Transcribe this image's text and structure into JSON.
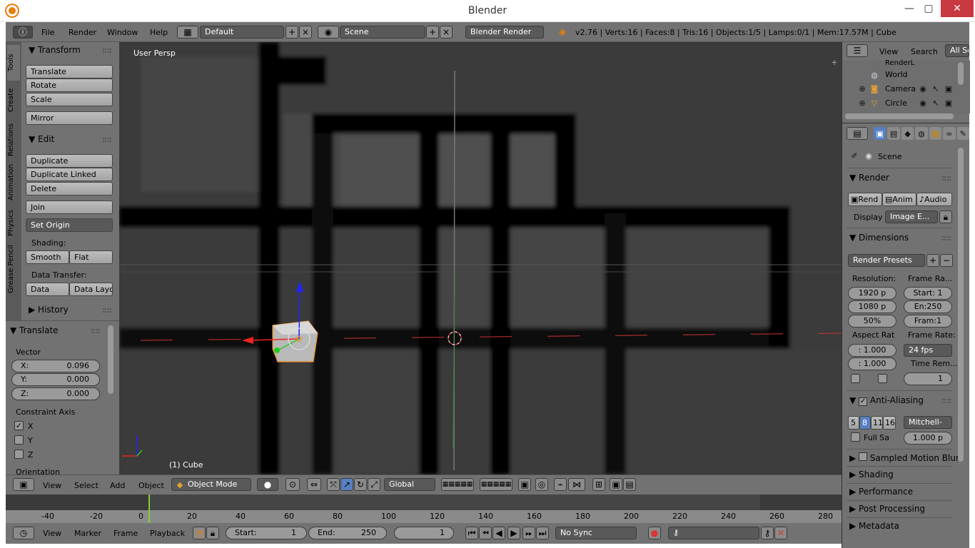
{
  "window": {
    "title": "Blender",
    "minimize": "—",
    "maximize": "▢",
    "close": "✕"
  },
  "info_header": {
    "menus": [
      "File",
      "Render",
      "Window",
      "Help"
    ],
    "screen_layout": "Default",
    "scene": "Scene",
    "render_engine": "Blender Render",
    "stats": "v2.76 | Verts:16 | Faces:8 | Tris:16 | Objects:1/5 | Lamps:0/1 | Mem:17.57M | Cube"
  },
  "tool_tabs": [
    "Tools",
    "Create",
    "Relations",
    "Animation",
    "Physics",
    "Grease Pencil"
  ],
  "tool_shelf": {
    "transform": {
      "title": "Transform",
      "buttons": [
        "Translate",
        "Rotate",
        "Scale"
      ],
      "mirror": "Mirror"
    },
    "edit": {
      "title": "Edit",
      "buttons": [
        "Duplicate",
        "Duplicate Linked",
        "Delete"
      ],
      "join": "Join",
      "set_origin": "Set Origin",
      "shading_label": "Shading:",
      "smooth": "Smooth",
      "flat": "Flat",
      "data_transfer_label": "Data Transfer:",
      "data": "Data",
      "data_layo": "Data Layo"
    },
    "history": {
      "title": "History"
    }
  },
  "operator_panel": {
    "title": "Translate",
    "vector_label": "Vector",
    "x_label": "X:",
    "x": "0.096",
    "y_label": "Y:",
    "y": "0.000",
    "z_label": "Z:",
    "z": "0.000",
    "constraint_label": "Constraint Axis",
    "axes": [
      "X",
      "Y",
      "Z"
    ],
    "axes_checked": [
      true,
      false,
      false
    ],
    "orientation_label": "Orientation"
  },
  "viewport": {
    "view_name": "User Persp",
    "object_name": "(1) Cube"
  },
  "outliner": {
    "view": "View",
    "search": "Search",
    "all_scenes": "All Sc",
    "items": [
      "RenderL",
      "World",
      "Camera",
      "Circle"
    ]
  },
  "properties": {
    "scene": "Scene",
    "render": {
      "title": "Render",
      "rend": "Rend",
      "anim": "Anim",
      "audio": "Audio",
      "display_label": "Display",
      "display_value": "Image E..."
    },
    "dimensions": {
      "title": "Dimensions",
      "presets": "Render Presets",
      "resolution_label": "Resolution:",
      "res_x": "1920 p",
      "res_y": "1080 p",
      "res_pct": "50%",
      "frame_range_label": "Frame Ra...",
      "start": "Start: 1",
      "end": "En:250",
      "step": "Fram:1",
      "aspect_label": "Aspect Rat",
      "aspect_x": ": 1.000",
      "aspect_y": ": 1.000",
      "frame_rate_label": "Frame Rate:",
      "fps": "24 fps",
      "time_remap_label": "Time Rem...",
      "time_remap_value": "1"
    },
    "anti_aliasing": {
      "title": "Anti-Aliasing",
      "samples": [
        "5",
        "8",
        "11",
        "16"
      ],
      "filter": "Mitchell-",
      "full_sample": "Full Sa",
      "filter_size": "1.000 p"
    },
    "collapsed": [
      "Sampled Motion Blur",
      "Shading",
      "Performance",
      "Post Processing",
      "Metadata"
    ]
  },
  "view3d_header": {
    "menus": [
      "View",
      "Select",
      "Add",
      "Object"
    ],
    "mode": "Object Mode",
    "orientation": "Global"
  },
  "timeline": {
    "ticks": [
      "-40",
      "-20",
      "0",
      "20",
      "40",
      "60",
      "80",
      "100",
      "120",
      "140",
      "160",
      "180",
      "200",
      "220",
      "240",
      "260",
      "280"
    ],
    "current_frame_pos": 0
  },
  "timeline_header": {
    "menus": [
      "View",
      "Marker",
      "Frame",
      "Playback"
    ],
    "start_label": "Start:",
    "start": "1",
    "end_label": "End:",
    "end": "250",
    "current": "1",
    "sync": "No Sync"
  },
  "colors": {
    "accent": "#5680c2",
    "panel": "#727272",
    "viewport": "#3a3a3a"
  }
}
